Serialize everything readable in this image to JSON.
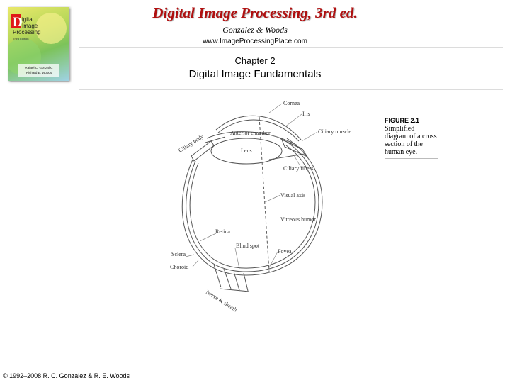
{
  "header": {
    "title": "Digital Image Processing, 3rd ed.",
    "authors": "Gonzalez & Woods",
    "website": "www.ImageProcessingPlace.com"
  },
  "book_cover": {
    "letter": "D",
    "line1": "igital",
    "line2": "Image",
    "line3": "Processing",
    "edition": "Third Edition",
    "author1": "Rafael C. Gonzalez",
    "author2": "Richard E. Woods"
  },
  "chapter": {
    "number": "Chapter 2",
    "title": "Digital Image Fundamentals"
  },
  "figure": {
    "label": "FIGURE 2.1",
    "caption_lines": [
      "Simplified",
      "diagram of a cross",
      "section of the",
      "human eye."
    ]
  },
  "eye_labels": {
    "cornea": "Cornea",
    "iris": "Iris",
    "ciliary_body": "Ciliary body",
    "anterior_chamber": "Anterior chamber",
    "ciliary_muscle": "Ciliary muscle",
    "lens": "Lens",
    "ciliary_fibers": "Ciliary fibers",
    "visual_axis": "Visual axis",
    "vitreous_humor": "Vitreous humor",
    "retina": "Retina",
    "blind_spot": "Blind spot",
    "fovea": "Fovea",
    "sclera": "Sclera",
    "choroid": "Choroid",
    "nerve_sheath": "Nerve & sheath"
  },
  "footer": {
    "copyright": "© 1992–2008 R. C. Gonzalez & R. E. Woods"
  }
}
